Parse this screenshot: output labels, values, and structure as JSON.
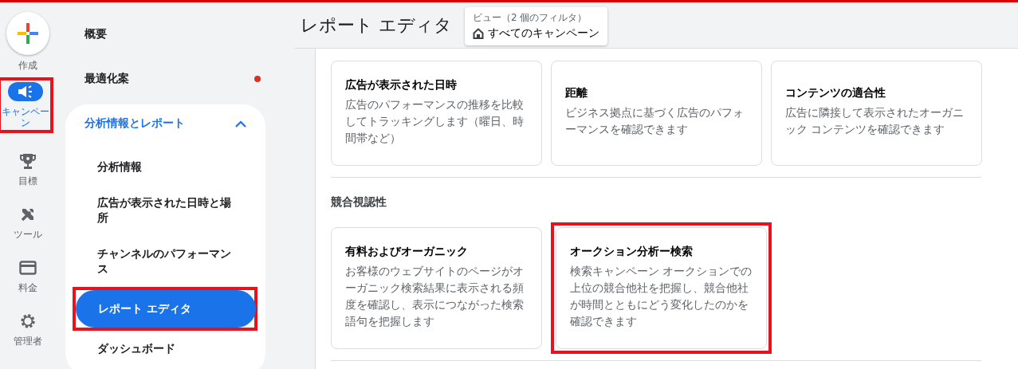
{
  "rail": {
    "create": {
      "label": "作成"
    },
    "items": [
      {
        "label": "キャンペーン",
        "selected": true,
        "highlighted": true
      },
      {
        "label": "目標",
        "selected": false,
        "highlighted": false
      },
      {
        "label": "ツール",
        "selected": false,
        "highlighted": false
      },
      {
        "label": "料金",
        "selected": false,
        "highlighted": false
      },
      {
        "label": "管理者",
        "selected": false,
        "highlighted": false
      }
    ]
  },
  "nav": {
    "items": [
      {
        "label": "概要",
        "alert": false
      },
      {
        "label": "最適化案",
        "alert": true
      }
    ],
    "section": {
      "label": "分析情報とレポート",
      "expanded": true,
      "children": [
        {
          "label": "分析情報",
          "selected": false,
          "highlighted": false
        },
        {
          "label": "広告が表示された日時と場所",
          "selected": false,
          "highlighted": false
        },
        {
          "label": "チャンネルのパフォーマンス",
          "selected": false,
          "highlighted": false
        },
        {
          "label": "レポート エディタ",
          "selected": true,
          "highlighted": true
        },
        {
          "label": "ダッシュボード",
          "selected": false,
          "highlighted": false
        }
      ]
    }
  },
  "header": {
    "title": "レポート エディタ",
    "view": {
      "caption": "ビュー（2 個のフィルタ）",
      "value": "すべてのキャンペーン"
    }
  },
  "sections": [
    {
      "cards": [
        {
          "title": "広告が表示された日時",
          "description": "広告のパフォーマンスの推移を比較してトラッキングします（曜日、時間帯など）",
          "highlighted": false
        },
        {
          "title": "距離",
          "description": "ビジネス拠点に基づく広告のパフォーマンスを確認できます",
          "highlighted": false
        },
        {
          "title": "コンテンツの適合性",
          "description": "広告に隣接して表示されたオーガニック コンテンツを確認できます",
          "highlighted": false
        }
      ]
    },
    {
      "title": "競合視認性",
      "cards": [
        {
          "title": "有料およびオーガニック",
          "description": "お客様のウェブサイトのページがオーガニック検索結果に表示される頻度を確認し、表示につながった検索語句を把握します",
          "highlighted": false
        },
        {
          "title": "オークション分析ー検索",
          "description": "検索キャンペーン オークションでの上位の競合他社を把握し、競合他社が時間とともにどう変化したのかを確認できます",
          "highlighted": true
        }
      ]
    }
  ]
}
